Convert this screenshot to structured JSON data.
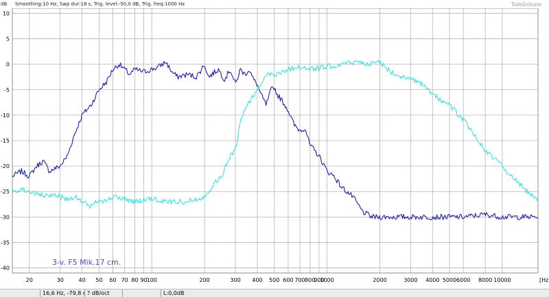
{
  "header": {
    "unit_label": "dB",
    "settings": "Smoothing:10 Hz, Swp dur:18 s, Trig. level:-50,0 dB, Trig. freq:1000 Hz",
    "brand": "Tombstone"
  },
  "annotation": "3-v. F5 Mik.17 cm.",
  "colors": {
    "series_1": "#1f1fb4",
    "series_2": "#3ee0e0",
    "annotation": "#5a3fd6",
    "grid": "#b4b4b4"
  },
  "status": {
    "cell_1": "",
    "cell_2": "16,6 Hz, -79,8 dB",
    "cell_3": "? dB/oct",
    "cell_4": "",
    "cell_5": "L:0,0dB"
  },
  "chart_data": {
    "type": "line",
    "x_scale": "log",
    "xlim": [
      16,
      16000
    ],
    "ylim": [
      -41,
      11
    ],
    "x_ticks": [
      20,
      30,
      40,
      50,
      60,
      70,
      80,
      90,
      100,
      200,
      300,
      400,
      500,
      600,
      700,
      800,
      900,
      1000,
      2000,
      3000,
      4000,
      5000,
      6000,
      8000,
      10000
    ],
    "x_tick_labels": [
      "20",
      "30",
      "40",
      "50",
      "60",
      "70",
      "80",
      "90",
      "100",
      "200",
      "300",
      "400",
      "500",
      "600",
      "700",
      "800",
      "900",
      "1000",
      "2000",
      "3000",
      "4000",
      "5000",
      "6000",
      "8000",
      "10000"
    ],
    "x_unit_label": "[Hz]",
    "y_ticks": [
      10,
      5,
      0,
      -5,
      -10,
      -15,
      -20,
      -25,
      -30,
      -35,
      -40
    ],
    "y_tick_labels": [
      "10",
      "5",
      "0",
      "-5",
      "-10",
      "-15",
      "-20",
      "-25",
      "-30",
      "-35",
      "-40"
    ],
    "grid": true,
    "series": [
      {
        "x": [
          16,
          18,
          20,
          22,
          24,
          26,
          28,
          30,
          33,
          36,
          40,
          45,
          50,
          55,
          60,
          65,
          70,
          75,
          80,
          90,
          100,
          110,
          120,
          130,
          140,
          160,
          180,
          200,
          210,
          220,
          240,
          260,
          280,
          300,
          320,
          340,
          360,
          380,
          400,
          420,
          450,
          480,
          500,
          520,
          550,
          600,
          650,
          700,
          750,
          800,
          850,
          900,
          1000,
          1100,
          1200,
          1400,
          1600,
          1800,
          2000,
          2500,
          3000,
          4000,
          5000,
          6000,
          8000,
          10000,
          12000,
          16000
        ],
        "y": [
          -22,
          -21,
          -22,
          -20,
          -19,
          -21,
          -20.5,
          -20,
          -18,
          -14,
          -10,
          -8,
          -5,
          -3.5,
          -1,
          0,
          -1,
          -2,
          -1,
          -1.5,
          -1,
          -0.5,
          0.5,
          -1.5,
          -2.5,
          -2,
          -2.5,
          0,
          -2.5,
          -2,
          -1,
          -3,
          -1,
          -4,
          -1,
          -2,
          -1,
          -3,
          -4,
          -6,
          -8,
          -5,
          -4.5,
          -6,
          -7,
          -9,
          -12,
          -13,
          -12.5,
          -16,
          -17,
          -18,
          -21,
          -22,
          -24,
          -26,
          -29,
          -30,
          -30,
          -30,
          -30,
          -30,
          -30,
          -30,
          -29.5,
          -30,
          -30,
          -30
        ]
      },
      {
        "x": [
          16,
          18,
          20,
          22,
          25,
          28,
          30,
          33,
          36,
          40,
          45,
          50,
          55,
          60,
          70,
          80,
          100,
          120,
          150,
          180,
          200,
          220,
          250,
          280,
          300,
          320,
          350,
          380,
          400,
          430,
          460,
          500,
          550,
          600,
          700,
          800,
          1000,
          1200,
          1500,
          1800,
          2000,
          2200,
          2500,
          3000,
          3500,
          4000,
          5000,
          6000,
          7000,
          8000,
          10000,
          12000,
          14000,
          16000
        ],
        "y": [
          -25,
          -24.5,
          -25,
          -25.5,
          -26,
          -25.5,
          -26,
          -26.5,
          -26,
          -27,
          -28,
          -26.5,
          -27,
          -26,
          -26.5,
          -27,
          -26.5,
          -27,
          -27,
          -26.5,
          -26,
          -24,
          -22,
          -18,
          -17,
          -11,
          -8,
          -6,
          -5,
          -3,
          -2,
          -2,
          -1.5,
          -1,
          -0.5,
          -1,
          -0.5,
          0,
          0.5,
          0,
          0.5,
          -1,
          -2,
          -3,
          -4,
          -6,
          -8,
          -11,
          -14,
          -17,
          -20,
          -23,
          -25,
          -26.5
        ]
      }
    ]
  }
}
